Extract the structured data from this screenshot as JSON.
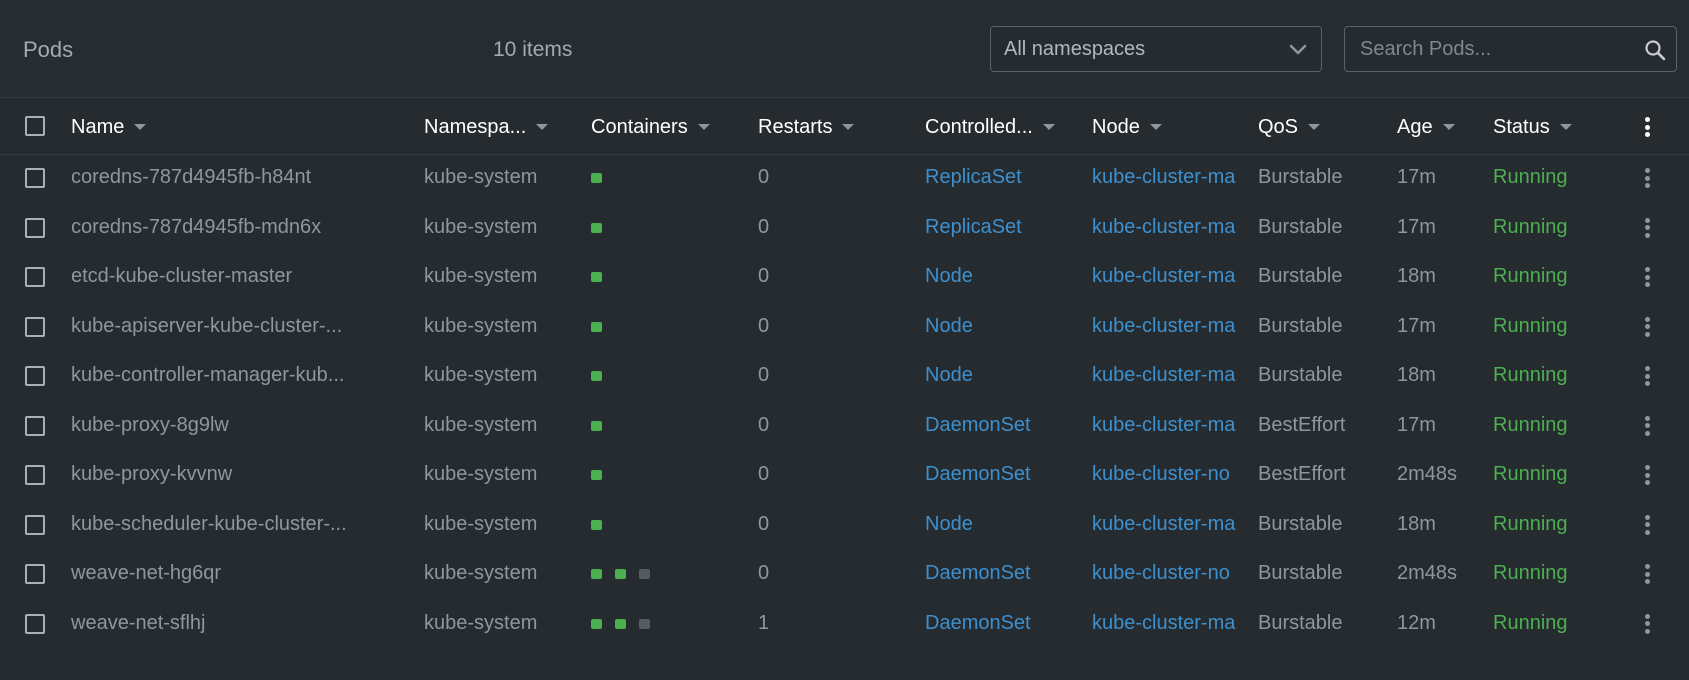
{
  "header": {
    "title": "Pods",
    "item_count": "10 items",
    "namespace_select": {
      "selected": "All namespaces"
    },
    "search": {
      "placeholder": "Search Pods..."
    }
  },
  "columns": [
    {
      "key": "name",
      "label": "Name"
    },
    {
      "key": "namespace",
      "label": "Namespa..."
    },
    {
      "key": "containers",
      "label": "Containers"
    },
    {
      "key": "restarts",
      "label": "Restarts"
    },
    {
      "key": "controlled_by",
      "label": "Controlled..."
    },
    {
      "key": "node",
      "label": "Node"
    },
    {
      "key": "qos",
      "label": "QoS"
    },
    {
      "key": "age",
      "label": "Age"
    },
    {
      "key": "status",
      "label": "Status"
    }
  ],
  "rows": [
    {
      "name": "coredns-787d4945fb-h84nt",
      "namespace": "kube-system",
      "containers": [
        "ready"
      ],
      "restarts": "0",
      "controlled_by": "ReplicaSet",
      "node": "kube-cluster-ma",
      "qos": "Burstable",
      "age": "17m",
      "status": "Running"
    },
    {
      "name": "coredns-787d4945fb-mdn6x",
      "namespace": "kube-system",
      "containers": [
        "ready"
      ],
      "restarts": "0",
      "controlled_by": "ReplicaSet",
      "node": "kube-cluster-ma",
      "qos": "Burstable",
      "age": "17m",
      "status": "Running"
    },
    {
      "name": "etcd-kube-cluster-master",
      "namespace": "kube-system",
      "containers": [
        "ready"
      ],
      "restarts": "0",
      "controlled_by": "Node",
      "node": "kube-cluster-ma",
      "qos": "Burstable",
      "age": "18m",
      "status": "Running"
    },
    {
      "name": "kube-apiserver-kube-cluster-...",
      "namespace": "kube-system",
      "containers": [
        "ready"
      ],
      "restarts": "0",
      "controlled_by": "Node",
      "node": "kube-cluster-ma",
      "qos": "Burstable",
      "age": "17m",
      "status": "Running"
    },
    {
      "name": "kube-controller-manager-kub...",
      "namespace": "kube-system",
      "containers": [
        "ready"
      ],
      "restarts": "0",
      "controlled_by": "Node",
      "node": "kube-cluster-ma",
      "qos": "Burstable",
      "age": "18m",
      "status": "Running"
    },
    {
      "name": "kube-proxy-8g9lw",
      "namespace": "kube-system",
      "containers": [
        "ready"
      ],
      "restarts": "0",
      "controlled_by": "DaemonSet",
      "node": "kube-cluster-ma",
      "qos": "BestEffort",
      "age": "17m",
      "status": "Running"
    },
    {
      "name": "kube-proxy-kvvnw",
      "namespace": "kube-system",
      "containers": [
        "ready"
      ],
      "restarts": "0",
      "controlled_by": "DaemonSet",
      "node": "kube-cluster-no",
      "qos": "BestEffort",
      "age": "2m48s",
      "status": "Running"
    },
    {
      "name": "kube-scheduler-kube-cluster-...",
      "namespace": "kube-system",
      "containers": [
        "ready"
      ],
      "restarts": "0",
      "controlled_by": "Node",
      "node": "kube-cluster-ma",
      "qos": "Burstable",
      "age": "18m",
      "status": "Running"
    },
    {
      "name": "weave-net-hg6qr",
      "namespace": "kube-system",
      "containers": [
        "ready",
        "ready",
        "terminated"
      ],
      "restarts": "0",
      "controlled_by": "DaemonSet",
      "node": "kube-cluster-no",
      "qos": "Burstable",
      "age": "2m48s",
      "status": "Running"
    },
    {
      "name": "weave-net-sflhj",
      "namespace": "kube-system",
      "containers": [
        "ready",
        "ready",
        "terminated"
      ],
      "restarts": "1",
      "controlled_by": "DaemonSet",
      "node": "kube-cluster-ma",
      "qos": "Burstable",
      "age": "12m",
      "status": "Running"
    }
  ],
  "colors": {
    "background": "#262b30",
    "link": "#3d90ce",
    "status_running": "#4caf50",
    "container_ready": "#4caf50",
    "container_terminated": "#555b61"
  },
  "icons": {
    "namespace_dropdown": "chevron-down-icon",
    "search": "search-icon",
    "row_menu": "vertical-ellipsis-icon"
  }
}
